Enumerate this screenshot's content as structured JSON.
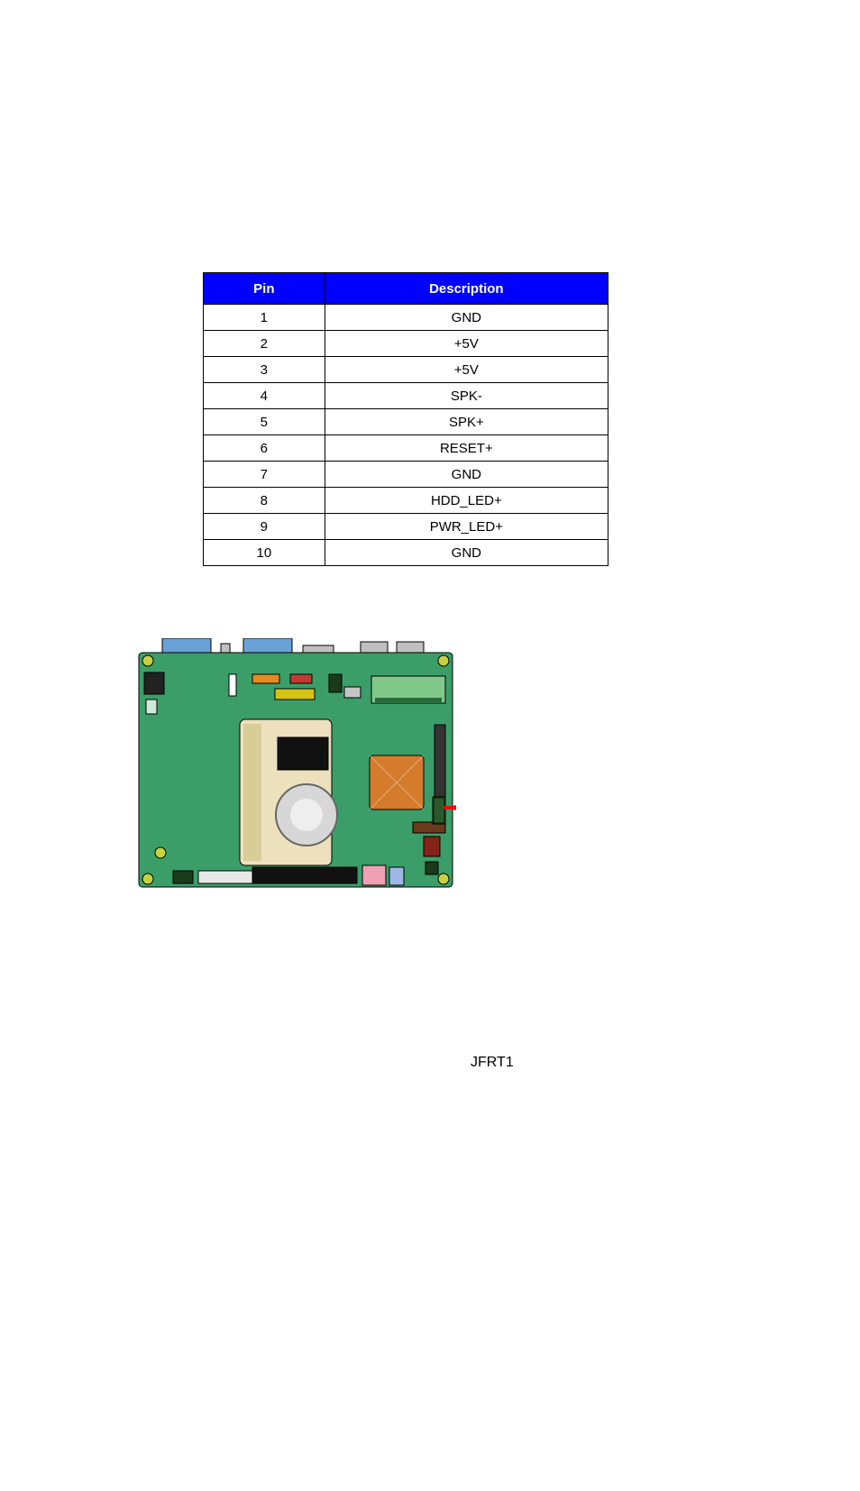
{
  "table": {
    "header": {
      "pin": "Pin",
      "desc": "Description"
    },
    "rows": [
      {
        "pin": "1",
        "desc": "GND"
      },
      {
        "pin": "2",
        "desc": "+5V"
      },
      {
        "pin": "3",
        "desc": "+5V"
      },
      {
        "pin": "4",
        "desc": "SPK-"
      },
      {
        "pin": "5",
        "desc": "SPK+"
      },
      {
        "pin": "6",
        "desc": "RESET+"
      },
      {
        "pin": "7",
        "desc": "GND"
      },
      {
        "pin": "8",
        "desc": "HDD_LED+"
      },
      {
        "pin": "9",
        "desc": "PWR_LED+"
      },
      {
        "pin": "10",
        "desc": "GND"
      }
    ]
  },
  "callout_label": "JFRT1"
}
